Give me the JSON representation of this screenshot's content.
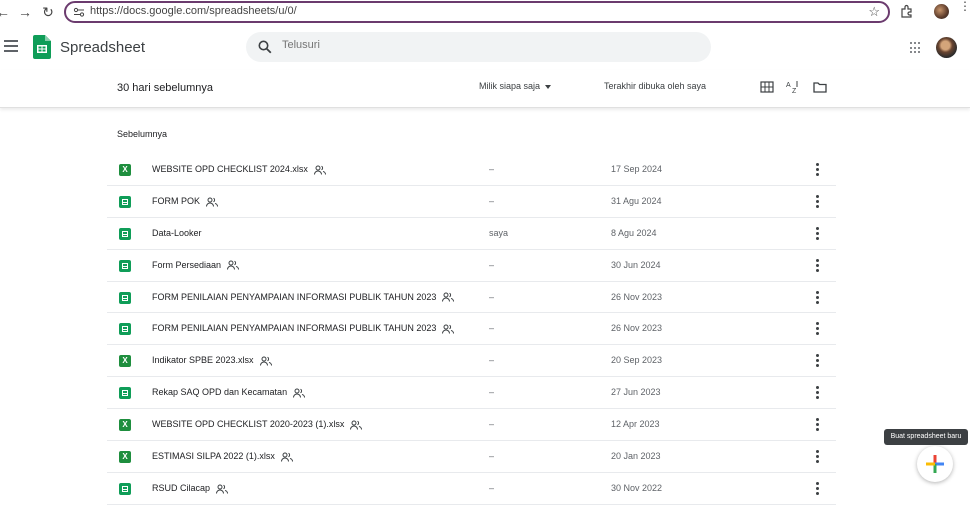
{
  "browser": {
    "url": "https://docs.google.com/spreadsheets/u/0/"
  },
  "app": {
    "title": "Spreadsheet"
  },
  "search": {
    "placeholder": "Telusuri"
  },
  "toolbar": {
    "section_title": "30 hari sebelumnya",
    "owner_filter": "Milik siapa saja",
    "sort_label": "Terakhir dibuka oleh saya"
  },
  "list": {
    "group_label": "Sebelumnya",
    "files": [
      {
        "name": "WEBSITE OPD CHECKLIST 2024.xlsx",
        "type": "xlsx",
        "shared": true,
        "owner": "–",
        "date": "17 Sep 2024"
      },
      {
        "name": "FORM POK",
        "type": "sheet",
        "shared": true,
        "owner": "–",
        "date": "31 Agu 2024"
      },
      {
        "name": "Data-Looker",
        "type": "sheet",
        "shared": false,
        "owner": "saya",
        "date": "8 Agu 2024"
      },
      {
        "name": "Form Persediaan",
        "type": "sheet",
        "shared": true,
        "owner": "–",
        "date": "30 Jun 2024"
      },
      {
        "name": "FORM PENILAIAN PENYAMPAIAN INFORMASI PUBLIK TAHUN 2023",
        "type": "sheet",
        "shared": true,
        "owner": "–",
        "date": "26 Nov 2023"
      },
      {
        "name": "FORM PENILAIAN PENYAMPAIAN INFORMASI PUBLIK TAHUN 2023",
        "type": "sheet",
        "shared": true,
        "owner": "–",
        "date": "26 Nov 2023"
      },
      {
        "name": "Indikator SPBE 2023.xlsx",
        "type": "xlsx",
        "shared": true,
        "owner": "–",
        "date": "20 Sep 2023"
      },
      {
        "name": "Rekap SAQ OPD dan Kecamatan",
        "type": "sheet",
        "shared": true,
        "owner": "–",
        "date": "27 Jun 2023"
      },
      {
        "name": "WEBSITE OPD CHECKLIST 2020-2023 (1).xlsx",
        "type": "xlsx",
        "shared": true,
        "owner": "–",
        "date": "12 Apr 2023"
      },
      {
        "name": "ESTIMASI SILPA 2022 (1).xlsx",
        "type": "xlsx",
        "shared": true,
        "owner": "–",
        "date": "20 Jan 2023"
      },
      {
        "name": "RSUD Cilacap",
        "type": "sheet",
        "shared": true,
        "owner": "–",
        "date": "30 Nov 2022"
      }
    ]
  },
  "fab": {
    "tooltip": "Buat spreadsheet baru"
  },
  "colors": {
    "sheets_green": "#0f9d58",
    "xlsx_green": "#1e8e3e",
    "url_border": "#6b3b6e"
  }
}
